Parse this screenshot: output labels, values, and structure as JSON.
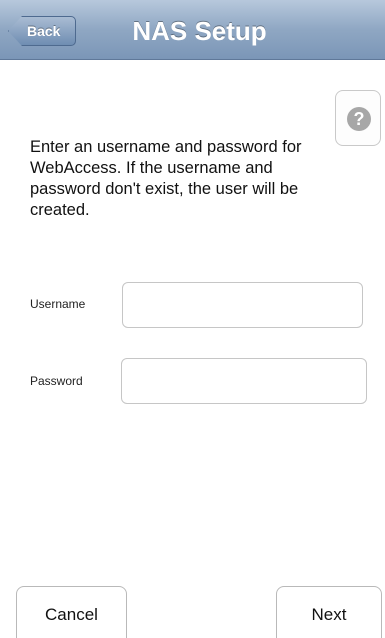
{
  "navbar": {
    "back_label": "Back",
    "title": "NAS Setup"
  },
  "help": {
    "icon": "question-mark-icon",
    "glyph": "?"
  },
  "instructions": {
    "text": "Enter an username and password for WebAccess. If the username and password don't exist, the user will be created."
  },
  "form": {
    "username_label": "Username",
    "username_value": "",
    "password_label": "Password",
    "password_value": ""
  },
  "footer": {
    "cancel_label": "Cancel",
    "next_label": "Next"
  }
}
